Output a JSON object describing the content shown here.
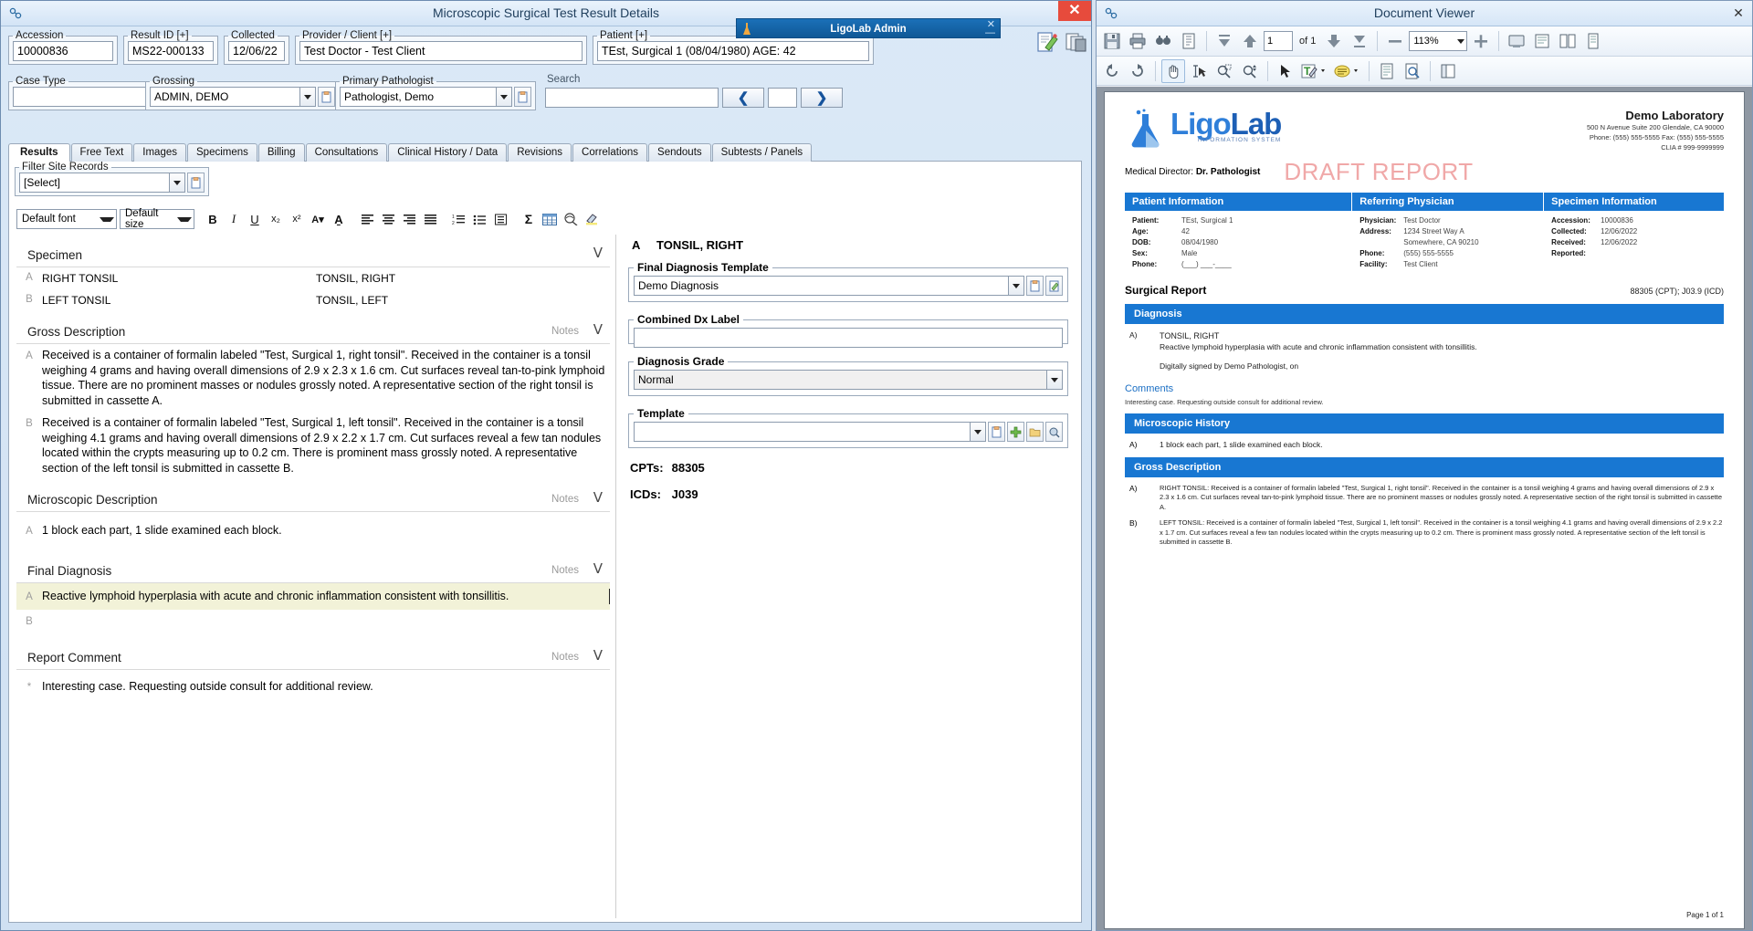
{
  "left_window": {
    "title": "Microscopic Surgical Test Result Details",
    "close_label": "✕",
    "header_fields": [
      {
        "legend": "Accession",
        "value": "10000836"
      },
      {
        "legend": "Result ID [+]",
        "value": "MS22-000133"
      },
      {
        "legend": "Collected",
        "value": "12/06/22"
      },
      {
        "legend": "Provider / Client [+]",
        "value": "Test Doctor - Test Client"
      },
      {
        "legend": "Patient [+]",
        "value": "TEst, Surgical 1 (08/04/1980) AGE: 42"
      }
    ],
    "header_row2": {
      "case_type_legend": "Case Type",
      "case_type_value": "",
      "grossing_legend": "Grossing",
      "grossing_value": "ADMIN, DEMO",
      "pathologist_legend": "Primary Pathologist",
      "pathologist_value": "Pathologist, Demo",
      "search_label": "Search",
      "search_value": "",
      "prev_label": "❮",
      "next_label": "❯",
      "mid_value": ""
    },
    "tabs": [
      {
        "label": "Results",
        "active": true
      },
      {
        "label": "Free Text",
        "active": false
      },
      {
        "label": "Images",
        "active": false
      },
      {
        "label": "Specimens",
        "active": false
      },
      {
        "label": "Billing",
        "active": false
      },
      {
        "label": "Consultations",
        "active": false
      },
      {
        "label": "Clinical History / Data",
        "active": false
      },
      {
        "label": "Revisions",
        "active": false
      },
      {
        "label": "Correlations",
        "active": false
      },
      {
        "label": "Sendouts",
        "active": false
      },
      {
        "label": "Subtests / Panels",
        "active": false
      }
    ],
    "filter": {
      "legend": "Filter Site Records",
      "value": "[Select]"
    },
    "rich_toolbar": {
      "font_select": "Default font",
      "size_select": "Default size",
      "buttons": [
        {
          "name": "bold-button",
          "glyph": "B"
        },
        {
          "name": "italic-button",
          "glyph": "I"
        },
        {
          "name": "underline-button",
          "glyph": "U"
        },
        {
          "name": "subscript-button",
          "glyph": "x₂"
        },
        {
          "name": "superscript-button",
          "glyph": "x²"
        },
        {
          "name": "font-color-button",
          "glyph": "A▾"
        },
        {
          "name": "highlight-color-button",
          "glyph": "A̱"
        },
        {
          "name": "align-left-button",
          "glyph": "≡"
        },
        {
          "name": "align-center-button",
          "glyph": "≡"
        },
        {
          "name": "align-right-button",
          "glyph": "≡"
        },
        {
          "name": "align-justify-button",
          "glyph": "≡"
        },
        {
          "name": "numbered-list-button",
          "glyph": "☰"
        },
        {
          "name": "bulleted-list-button",
          "glyph": "☰"
        },
        {
          "name": "indent-button",
          "glyph": "▤"
        },
        {
          "name": "sigma-button",
          "glyph": "Σ"
        },
        {
          "name": "insert-table-button",
          "glyph": "▦"
        },
        {
          "name": "spellcheck-button",
          "glyph": "⚫"
        },
        {
          "name": "highlighter-button",
          "glyph": "✎"
        }
      ]
    },
    "sections": {
      "specimen": {
        "title": "Specimen",
        "rows": [
          {
            "letter": "A",
            "name": "RIGHT TONSIL",
            "site": "TONSIL, RIGHT"
          },
          {
            "letter": "B",
            "name": "LEFT TONSIL",
            "site": "TONSIL, LEFT"
          }
        ]
      },
      "gross_description": {
        "title": "Gross Description",
        "notes": "Notes",
        "paragraphs": [
          {
            "letter": "A",
            "text": "Received is a container of formalin labeled \"Test, Surgical 1, right tonsil\".  Received in the container is a tonsil weighing 4 grams and having overall dimensions of 2.9 x 2.3 x 1.6 cm.  Cut surfaces reveal tan-to-pink lymphoid tissue.  There are no prominent masses or nodules grossly noted.   A representative section of the right tonsil is submitted in cassette A."
          },
          {
            "letter": "B",
            "text": "Received is a container of formalin labeled \"Test, Surgical 1, left tonsil\".  Received in the container is a tonsil weighing 4.1 grams and having overall dimensions of 2.9 x 2.2 x 1.7 cm.  Cut surfaces reveal a few tan nodules located within the crypts measuring up to 0.2 cm.  There is prominent mass grossly noted.   A representative section of the left tonsil is submitted in cassette B."
          }
        ]
      },
      "microscopic_description": {
        "title": "Microscopic Description",
        "notes": "Notes",
        "paragraphs": [
          {
            "letter": "A",
            "text": "1 block each part, 1 slide examined each block."
          }
        ]
      },
      "final_diagnosis": {
        "title": "Final Diagnosis",
        "notes": "Notes",
        "paragraphs": [
          {
            "letter": "A",
            "text": "Reactive lymphoid hyperplasia with acute and chronic inflammation consistent with tonsillitis."
          },
          {
            "letter": "B",
            "text": ""
          }
        ]
      },
      "report_comment": {
        "title": "Report Comment",
        "notes": "Notes",
        "paragraphs": [
          {
            "letter": "*",
            "text": "Interesting case. Requesting outside consult for additional review."
          }
        ]
      }
    },
    "dx_panel": {
      "heading_letter": "A",
      "heading_text": "TONSIL, RIGHT",
      "final_dx_template_legend": "Final Diagnosis Template",
      "final_dx_template_value": "Demo Diagnosis",
      "combined_dx_legend": "Combined Dx Label",
      "combined_dx_value": "",
      "grade_legend": "Diagnosis Grade",
      "grade_value": "Normal",
      "template_legend": "Template",
      "template_value": "",
      "cpts_label": "CPTs:",
      "cpts_value": "88305",
      "icds_label": "ICDs:",
      "icds_value": "J039"
    },
    "mini_window": {
      "title": "LigoLab Admin",
      "close": "✕",
      "minimize": "—"
    }
  },
  "right_window": {
    "title": "Document Viewer",
    "close_label": "✕",
    "toolbar1": [
      {
        "name": "save-button",
        "glyph": "💾"
      },
      {
        "name": "print-button",
        "glyph": "🖨"
      },
      {
        "name": "find-button",
        "glyph": "🔍"
      },
      {
        "name": "page-setup-button",
        "glyph": "📄"
      }
    ],
    "nav": {
      "first_page": "⏫",
      "prev_page": "↑",
      "page_value": "1",
      "of_label": "of 1",
      "next_page": "↓",
      "last_page": "⏬"
    },
    "zoom": {
      "out_label": "—",
      "value": "113%",
      "in_label": "＋"
    },
    "view_buttons": [
      {
        "name": "fit-page-button",
        "glyph": "❐"
      },
      {
        "name": "fit-width-button",
        "glyph": "▭"
      },
      {
        "name": "two-page-button",
        "glyph": "▥"
      },
      {
        "name": "single-page-button",
        "glyph": "▯"
      }
    ],
    "toolbar2": [
      {
        "name": "rotate-left-icon",
        "glyph": "↺"
      },
      {
        "name": "rotate-right-icon",
        "glyph": "↻"
      },
      {
        "name": "pan-hand-icon",
        "glyph": "✋"
      },
      {
        "name": "text-select-icon",
        "glyph": "I"
      },
      {
        "name": "zoom-area-icon",
        "glyph": "⌕"
      },
      {
        "name": "zoom-dynamic-icon",
        "glyph": "⌕"
      },
      {
        "name": "select-arrow-icon",
        "glyph": "➤"
      },
      {
        "name": "text-markup-icon",
        "glyph": "T"
      },
      {
        "name": "sticky-note-icon",
        "glyph": "●"
      },
      {
        "name": "page-view-icon",
        "glyph": "▤"
      },
      {
        "name": "search-doc-icon",
        "glyph": "🔎"
      },
      {
        "name": "thumbnails-icon",
        "glyph": "▧"
      }
    ],
    "page_footer": "Page 1 of 1"
  },
  "report": {
    "brand": {
      "name_part1": "Ligo",
      "name_part2": "Lab",
      "subtitle": "INFORMATION SYSTEM"
    },
    "lab": {
      "name": "Demo Laboratory",
      "address": "500 N Avenue Suite 200  Glendale, CA 90000",
      "contact": "Phone: (555) 555-5555    Fax: (555) 555-5555",
      "clia": "CLIA # 999-9999999"
    },
    "medical_director_label": "Medical Director:",
    "medical_director_value": "Dr. Pathologist",
    "draft_watermark": "DRAFT REPORT",
    "columns": [
      {
        "header": "Patient Information",
        "rows": [
          {
            "k": "Patient:",
            "v": "TEst, Surgical 1"
          },
          {
            "k": "Age:",
            "v": "42"
          },
          {
            "k": "DOB:",
            "v": "08/04/1980"
          },
          {
            "k": "Sex:",
            "v": "Male"
          },
          {
            "k": "Phone:",
            "v": "(___) ___-____"
          }
        ]
      },
      {
        "header": "Referring Physician",
        "rows": [
          {
            "k": "Physician:",
            "v": "Test Doctor"
          },
          {
            "k": "Address:",
            "v": "1234 Street Way A"
          },
          {
            "k": "",
            "v": "Somewhere, CA 90210"
          },
          {
            "k": "Phone:",
            "v": "(555) 555-5555"
          },
          {
            "k": "Facility:",
            "v": "Test Client"
          }
        ]
      },
      {
        "header": "Specimen Information",
        "rows": [
          {
            "k": "Accession:",
            "v": "10000836"
          },
          {
            "k": "Collected:",
            "v": "12/06/2022"
          },
          {
            "k": "Received:",
            "v": "12/06/2022"
          },
          {
            "k": "Reported:",
            "v": ""
          }
        ]
      }
    ],
    "surgical_report_title": "Surgical Report",
    "surgical_report_codes": "88305 (CPT); J03.9 (ICD)",
    "diagnosis_band": "Diagnosis",
    "diagnosis_letter": "A)",
    "diagnosis_caption": "TONSIL, RIGHT",
    "diagnosis_text": "Reactive lymphoid hyperplasia with acute and chronic inflammation consistent with tonsillitis.",
    "signature": "Digitally signed by Demo Pathologist,   on",
    "comments_title": "Comments",
    "comments_text": "Interesting case. Requesting outside consult for additional review.",
    "microscopic_band": "Microscopic History",
    "microscopic_letter": "A)",
    "microscopic_text": "1 block each part, 1 slide examined each block.",
    "gross_band": "Gross Description",
    "gross_entries": [
      {
        "letter": "A)",
        "text": "RIGHT TONSIL: Received is a container of formalin labeled \"Test, Surgical 1, right tonsil\".  Received in the container is a tonsil weighing 4 grams and having overall dimensions of 2.9 x 2.3 x 1.6 cm.  Cut surfaces reveal tan-to-pink lymphoid tissue.  There are no prominent masses or nodules grossly noted.   A representative section of the right tonsil is submitted in cassette A."
      },
      {
        "letter": "B)",
        "text": "LEFT TONSIL: Received is a container of formalin labeled \"Test, Surgical 1, left tonsil\".  Received in the container is a tonsil weighing 4.1 grams and having overall dimensions of 2.9 x 2.2 x 1.7 cm.  Cut surfaces reveal a few tan nodules located within the crypts measuring up to 0.2 cm.  There is prominent mass grossly noted.   A representative section of the left tonsil is submitted in cassette B."
      }
    ]
  },
  "colors": {
    "brand_blue": "#1877d2",
    "accent_dark_blue": "#0f5896",
    "draft_pink": "#f0a8a8",
    "close_red": "#e74b3c"
  }
}
